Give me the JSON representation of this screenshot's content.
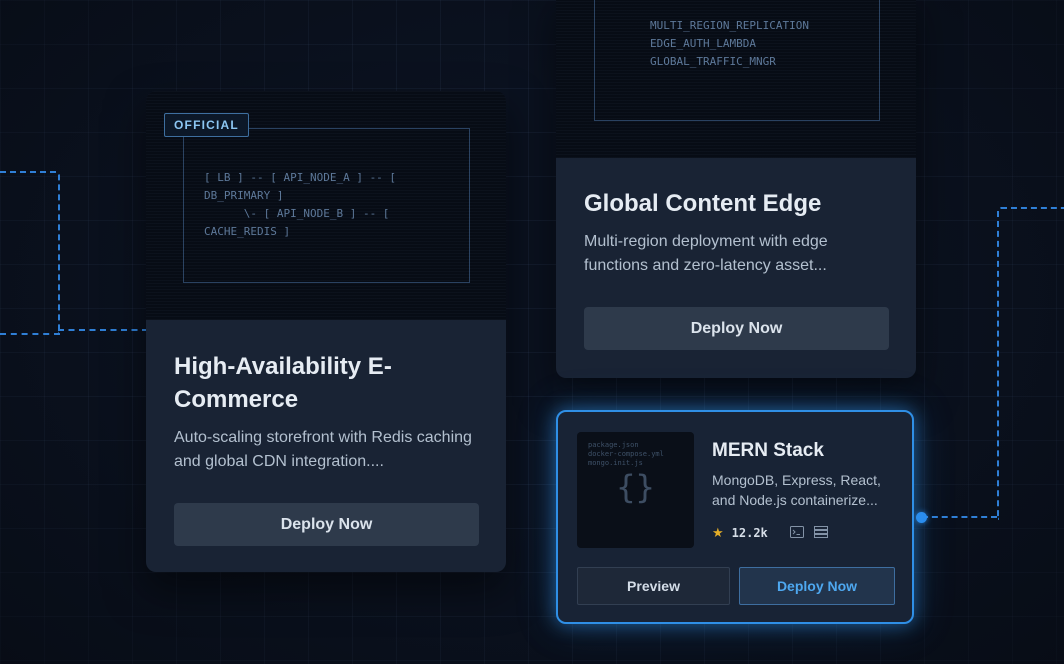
{
  "cards": {
    "ecommerce": {
      "badge": "OFFICIAL",
      "diagram": "[ LB ] -- [ API_NODE_A ] -- [\nDB_PRIMARY ]\n      \\- [ API_NODE_B ] -- [\nCACHE_REDIS ]",
      "title": "High-Availability E-Commerce",
      "description": "Auto-scaling storefront with Redis caching and global CDN integration....",
      "deploy_label": "Deploy Now"
    },
    "edge": {
      "diagram": "MULTI_REGION_REPLICATION\nEDGE_AUTH_LAMBDA\nGLOBAL_TRAFFIC_MNGR",
      "title": "Global Content Edge",
      "description": "Multi-region deployment with edge functions and zero-latency asset...",
      "deploy_label": "Deploy Now"
    },
    "mern": {
      "thumb_files": "package.json\ndocker-compose.yml\nmongo.init.js",
      "thumb_glyph": "{}",
      "title": "MERN Stack",
      "description": "MongoDB, Express, React, and Node.js containerize...",
      "stars": "12.2k",
      "preview_label": "Preview",
      "deploy_label": "Deploy Now",
      "icons": [
        "star-icon",
        "terminal-icon",
        "database-icon"
      ]
    }
  },
  "colors": {
    "background": "#0b1220",
    "card": "#192334",
    "accent": "#2f8fe6",
    "deploy_text_accent": "#4ea8f0",
    "star": "#e4ae28"
  }
}
